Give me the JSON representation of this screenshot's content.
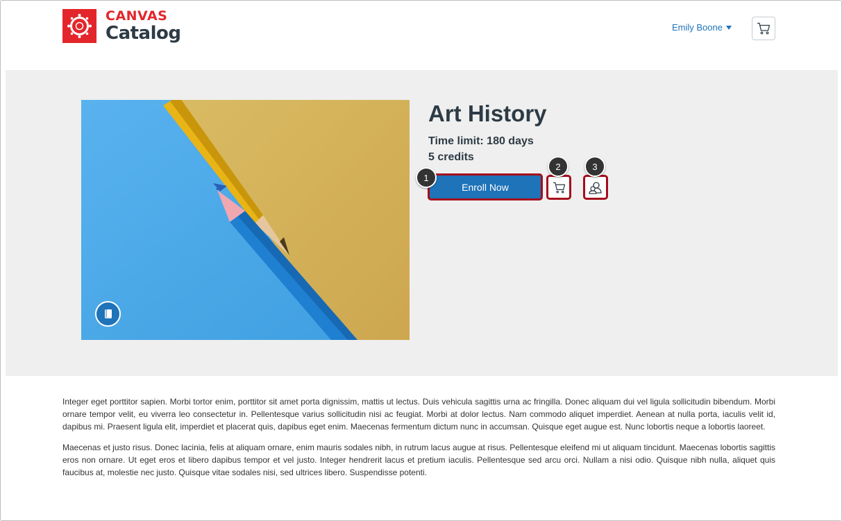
{
  "brand": {
    "word1": "CANVAS",
    "word2": "Catalog",
    "accent_color": "#e2262b",
    "logo_icon": "canvas-logo-icon"
  },
  "header": {
    "user_name": "Emily Boone",
    "cart_icon": "cart-icon"
  },
  "course": {
    "title": "Art History",
    "time_limit": "Time limit: 180 days",
    "credits": "5 credits",
    "enroll_label": "Enroll Now",
    "add_to_cart_icon": "cart-icon",
    "gift_icon": "users-icon",
    "type_icon": "book-icon",
    "button_color": "#1e73b9"
  },
  "callouts": [
    "1",
    "2",
    "3"
  ],
  "description": {
    "paragraphs": [
      "Integer eget porttitor sapien. Morbi tortor enim, porttitor sit amet porta dignissim, mattis ut lectus. Duis vehicula sagittis urna ac fringilla. Donec aliquam dui vel ligula sollicitudin bibendum. Morbi ornare tempor velit, eu viverra leo consectetur in. Pellentesque varius sollicitudin nisi ac feugiat. Morbi at dolor lectus. Nam commodo aliquet imperdiet. Aenean at nulla porta, iaculis velit id, dapibus mi. Praesent ligula elit, imperdiet et placerat quis, dapibus eget enim. Maecenas fermentum dictum nunc in accumsan. Quisque eget augue est. Nunc lobortis neque a lobortis laoreet.",
      "Maecenas et justo risus. Donec lacinia, felis at aliquam ornare, enim mauris sodales nibh, in rutrum lacus augue at risus. Pellentesque eleifend mi ut aliquam tincidunt. Maecenas lobortis sagittis eros non ornare. Ut eget eros et libero dapibus tempor et vel justo. Integer hendrerit lacus et pretium iaculis. Pellentesque sed arcu orci. Nullam a nisi odio. Quisque nibh nulla, aliquet quis faucibus at, molestie nec justo. Quisque vitae sodales nisi, sed ultrices libero. Suspendisse potenti."
    ]
  }
}
